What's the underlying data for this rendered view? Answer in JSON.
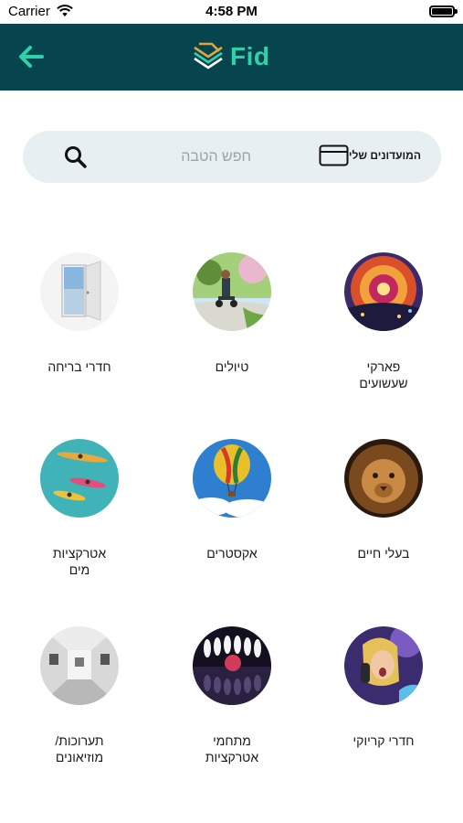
{
  "status_bar": {
    "carrier": "Carrier",
    "time": "4:58 PM"
  },
  "header": {
    "logo_text": "Fid"
  },
  "search": {
    "placeholder": "חפש הטבה",
    "clubs_label": "המועדונים שלי"
  },
  "categories": [
    {
      "label": "פארקי\nשעשועים",
      "image": "amusement-park"
    },
    {
      "label": "טיולים",
      "image": "segway-trip"
    },
    {
      "label": "חדרי בריחה",
      "image": "open-door"
    },
    {
      "label": "בעלי חיים",
      "image": "lion"
    },
    {
      "label": "אקסטרים",
      "image": "hot-air-balloon"
    },
    {
      "label": "אטרקציות\nמים",
      "image": "kayaks"
    },
    {
      "label": "חדרי קריוקי",
      "image": "singing-woman"
    },
    {
      "label": "מתחמי\nאטרקציות",
      "image": "bowling"
    },
    {
      "label": "תערוכות/\nמוזיאונים",
      "image": "gallery"
    }
  ]
}
